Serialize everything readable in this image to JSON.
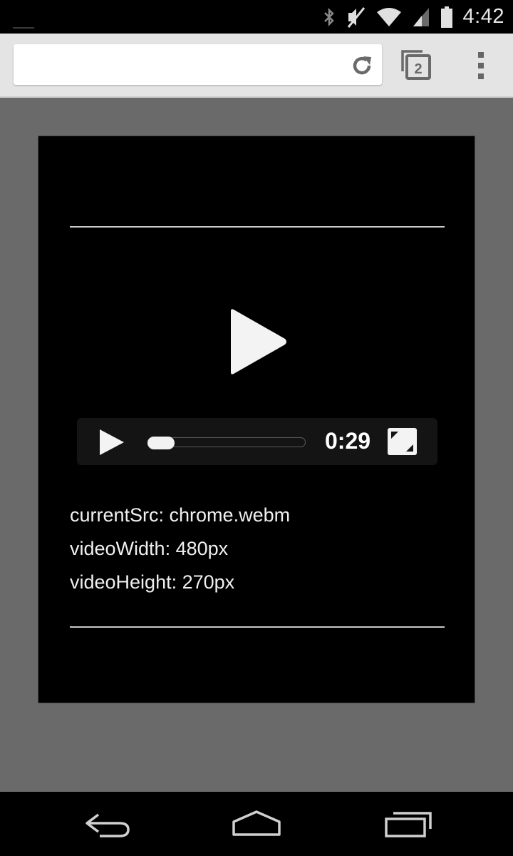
{
  "status_bar": {
    "time": "4:42",
    "icons": [
      "bluetooth-icon",
      "mute-icon",
      "wifi-icon",
      "cell-signal-icon",
      "battery-icon"
    ]
  },
  "browser": {
    "url": "",
    "tab_count": "2",
    "icons": [
      "reload-icon",
      "tabs-icon",
      "overflow-menu-icon"
    ]
  },
  "video": {
    "time": "0:29",
    "progress": 0.0,
    "icons": [
      "large-play-icon",
      "play-icon",
      "fullscreen-icon"
    ]
  },
  "info": {
    "current_src": "currentSrc: chrome.webm",
    "video_width": "videoWidth: 480px",
    "video_height": "videoHeight: 270px"
  },
  "colors": {
    "page_background": "#6a6a6a",
    "panel_background": "#000000",
    "toolbar_background": "#e4e4e4"
  },
  "nav_bar": {
    "icons": [
      "back-icon",
      "home-icon",
      "recent-apps-icon"
    ]
  }
}
